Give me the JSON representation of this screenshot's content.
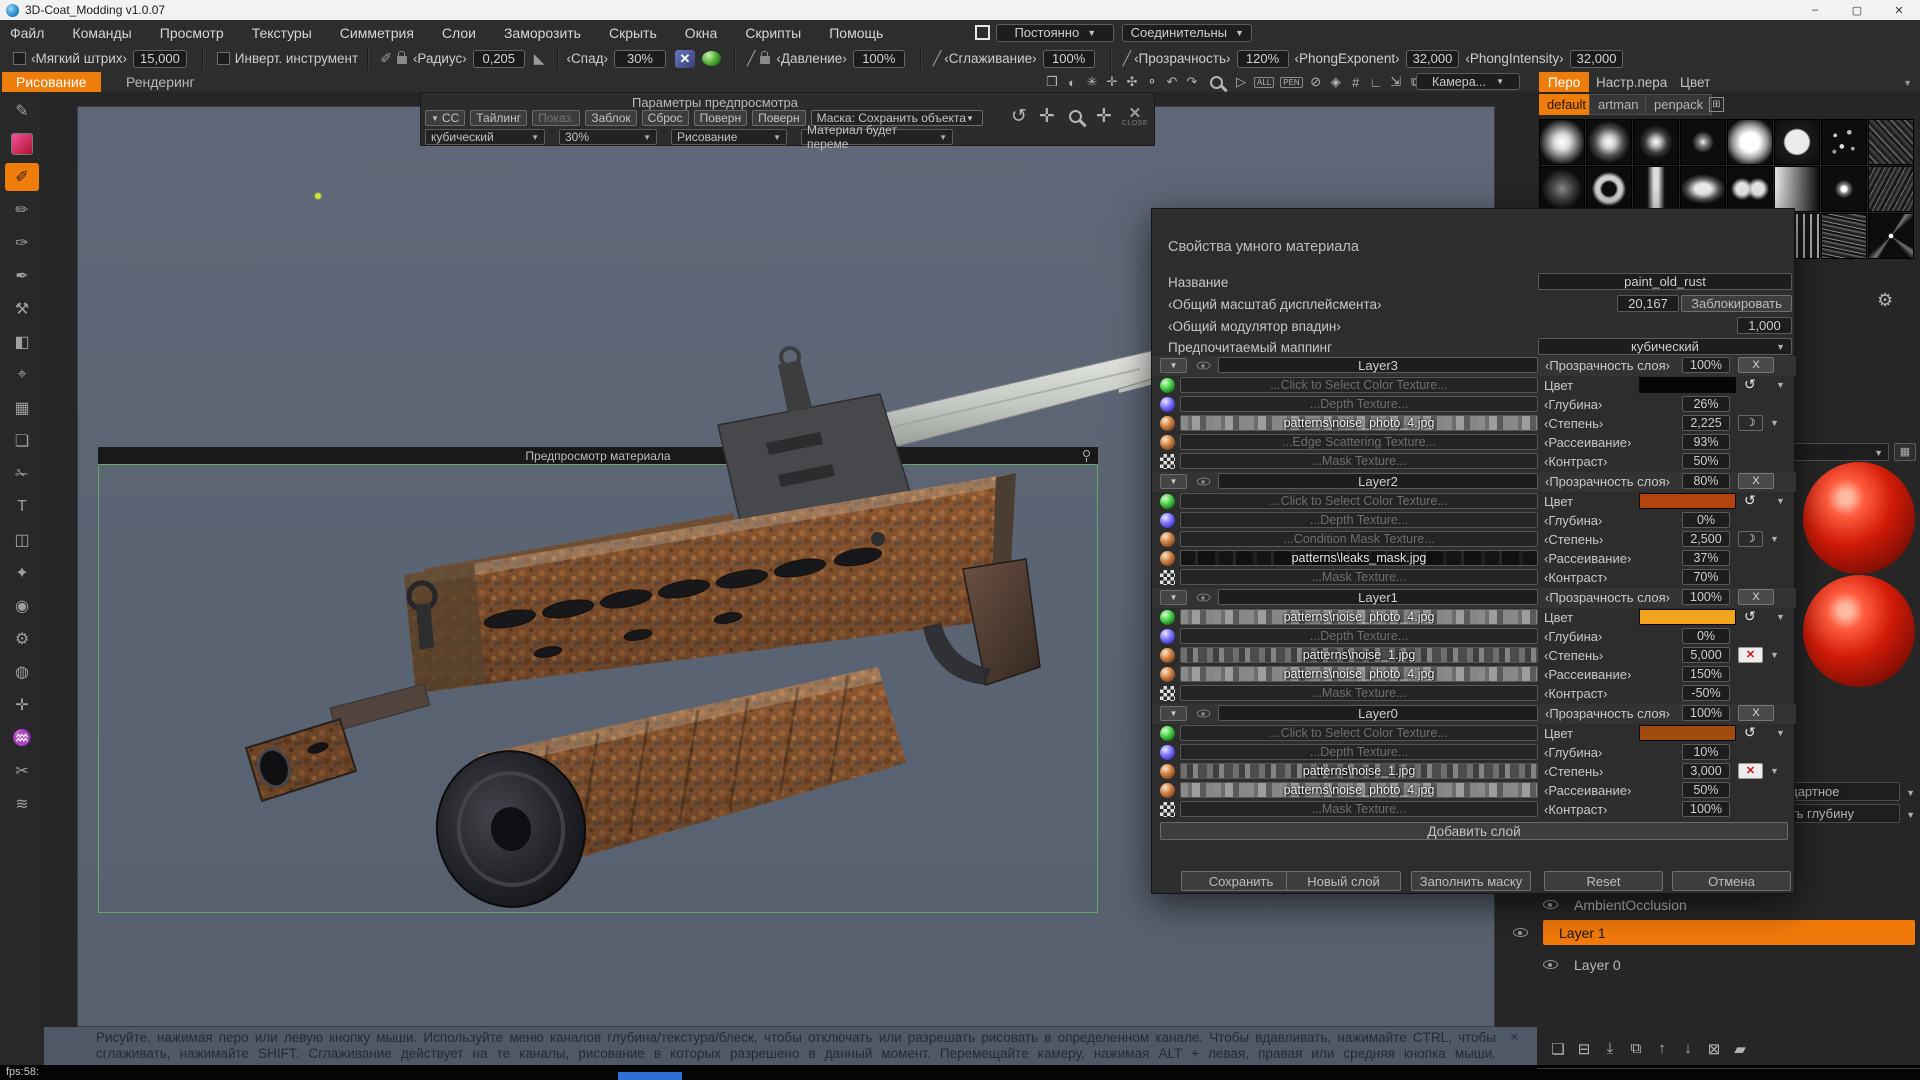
{
  "window": {
    "title": "3D-Coat_Modding v1.0.07",
    "minimize": "–",
    "maximize": "▢",
    "close": "✕"
  },
  "menu": {
    "items": [
      "Файл",
      "Команды",
      "Просмотр",
      "Текстуры",
      "Симметрия",
      "Слои",
      "Заморозить",
      "Скрыть",
      "Окна",
      "Скрипты",
      "Помощь"
    ],
    "persist_dropdown": "Постоянно",
    "connective_dropdown": "Соединительны"
  },
  "toolbar": {
    "soft_stroke_label": "‹Мягкий штрих›",
    "soft_stroke_value": "15,000",
    "invert_label": "Инверт.  инструмент",
    "radius_label": "‹Радиус›",
    "radius_value": "0,205",
    "falloff_label": "‹Спад›",
    "falloff_value": "30%",
    "pressure_label": "‹Давление›",
    "pressure_value": "100%",
    "smoothing_label": "‹Сглаживание›",
    "smoothing_value": "100%",
    "opacity_label": "‹Прозрачность›",
    "opacity_value": "120%",
    "phong_exponent_label": "‹PhongExponent›",
    "phong_exponent_value": "32,000",
    "phong_intensity_label": "‹PhongIntensity›",
    "phong_intensity_value": "32,000"
  },
  "workspace_tabs": {
    "paint": "Рисование",
    "render": "Рендеринг"
  },
  "view_toolbar": {
    "icons": [
      {
        "name": "frame-icon",
        "g": "❒"
      },
      {
        "name": "contrast-icon",
        "g": "◐"
      },
      {
        "name": "flower-icon",
        "g": "✳"
      },
      {
        "name": "cross-icon",
        "g": "✛"
      },
      {
        "name": "hand-icon",
        "g": "✣"
      },
      {
        "name": "drop-icon",
        "g": "⚬"
      },
      {
        "name": "undo-icon",
        "g": "↶"
      },
      {
        "name": "redo-icon",
        "g": "↷"
      },
      {
        "name": "magnifier-icon",
        "g": "mag"
      },
      {
        "name": "play-icon",
        "g": "▷"
      },
      {
        "name": "select-all-button",
        "g": "ALL",
        "txt": true
      },
      {
        "name": "select-pen-button",
        "g": "PEN",
        "txt": true
      },
      {
        "name": "ban-icon",
        "g": "⊘"
      },
      {
        "name": "cube-icon",
        "g": "◈"
      },
      {
        "name": "grid-icon",
        "g": "#"
      },
      {
        "name": "axis-icon",
        "g": "∟"
      },
      {
        "name": "expand-icon",
        "g": "⇲"
      },
      {
        "name": "pages-icon",
        "g": "⧉"
      }
    ],
    "camera_label": "Камера..."
  },
  "right_tabs": {
    "pen": "Перо",
    "pen_settings": "Настр.пера",
    "color": "Цвет"
  },
  "pen_panel": {
    "tabs": [
      "default",
      "artman",
      "penpack"
    ],
    "thumbs": [
      "dot-xl",
      "dot-l",
      "dot-m",
      "dot-s",
      "dot-bright",
      "dot-hard",
      "spray",
      "noise",
      "dot-faint",
      "ring",
      "bar",
      "softrect",
      "double",
      "gradh",
      "dot-tiny",
      "noise2",
      "tex-dots",
      "tex-diag",
      "tex-grid",
      "tex-check",
      "tex-spots",
      "tex-vlines",
      "tex-noise",
      "tex-star"
    ]
  },
  "preview_params": {
    "title": "Параметры  предпросмотра",
    "buttons": [
      {
        "label": "СС",
        "pre": true
      },
      {
        "label": "Тайлинг"
      },
      {
        "label": "Показ.",
        "dim": true
      },
      {
        "label": "Заблок"
      },
      {
        "label": "Сброс"
      },
      {
        "label": "Поверн"
      },
      {
        "label": "Поверн"
      }
    ],
    "mask_dropdown": "Маска:  Сохранить  объекта",
    "dropdowns": [
      "кубический",
      "30%",
      "Рисование",
      "Материал будет переме"
    ],
    "close_label": "CLOSE"
  },
  "preview_window": {
    "title": "Предпросмотр  материала"
  },
  "material_dialog": {
    "title": "Свойства  умного  материала",
    "name_label": "Название",
    "name_value": "paint_old_rust",
    "displacement_label": "‹Общий  масштаб  дисплейсмента›",
    "displacement_value": "20,167",
    "lock_button": "Заблокировать",
    "cavity_label": "‹Общий  модулятор  впадин›",
    "cavity_value": "1,000",
    "mapping_label": "Предпочитаемый  маппинг",
    "mapping_value": "кубический",
    "opacity_label": "‹Прозрачность  слоя›",
    "row_labels": [
      "Цвет",
      "‹Глубина›",
      "‹Степень›",
      "‹Рассеивание›",
      "‹Контраст›"
    ],
    "close_x": "X",
    "add_layer_button": "Добавить  слой",
    "buttons": [
      "Сохранить",
      "Новый  слой",
      "Заполнить  маску",
      "Reset",
      "Отмена"
    ],
    "layers": [
      {
        "name": "Layer3",
        "opacity": "100%",
        "color_hex": "#060606",
        "slots": [
          {
            "t": "...Click  to  Select  Color  Texture...",
            "f": "none"
          },
          {
            "t": "...Depth  Texture...",
            "f": "none"
          },
          {
            "t": "patterns\\noise_photo_4.jpg",
            "f": "noise"
          },
          {
            "t": "...Edge  Scattering  Texture...",
            "f": "none"
          },
          {
            "t": "...Mask  Texture...",
            "f": "none"
          }
        ],
        "depth": "26%",
        "degree": "2,225",
        "degree_icon": "moon",
        "scattering": "93%",
        "contrast": "50%"
      },
      {
        "name": "Layer2",
        "opacity": "80%",
        "color_hex": "#b5430c",
        "slots": [
          {
            "t": "...Click  to  Select  Color  Texture...",
            "f": "none"
          },
          {
            "t": "...Depth  Texture...",
            "f": "none"
          },
          {
            "t": "...Condition  Mask  Texture...",
            "f": "none"
          },
          {
            "t": "patterns\\leaks_mask.jpg",
            "f": "dark"
          },
          {
            "t": "...Mask  Texture...",
            "f": "none"
          }
        ],
        "depth": "0%",
        "degree": "2,500",
        "degree_icon": "moon",
        "scattering": "37%",
        "contrast": "70%"
      },
      {
        "name": "Layer1",
        "opacity": "100%",
        "color_hex": "#f3a41e",
        "slots": [
          {
            "t": "patterns\\noise_photo_4.jpg",
            "f": "noise"
          },
          {
            "t": "...Depth  Texture...",
            "f": "none"
          },
          {
            "t": "patterns\\noise_1.jpg",
            "f": "noise2"
          },
          {
            "t": "patterns\\noise_photo_4.jpg",
            "f": "noise"
          },
          {
            "t": "...Mask  Texture...",
            "f": "none"
          }
        ],
        "depth": "0%",
        "degree": "5,000",
        "degree_icon": "redx",
        "scattering": "150%",
        "contrast": "-50%"
      },
      {
        "name": "Layer0",
        "opacity": "100%",
        "color_hex": "#a24b10",
        "slots": [
          {
            "t": "...Click  to  Select  Color  Texture...",
            "f": "none"
          },
          {
            "t": "...Depth  Texture...",
            "f": "none"
          },
          {
            "t": "patterns\\noise_1.jpg",
            "f": "noise2"
          },
          {
            "t": "patterns\\noise_photo_4.jpg",
            "f": "noise"
          },
          {
            "t": "...Mask  Texture...",
            "f": "none"
          }
        ],
        "depth": "10%",
        "degree": "3,000",
        "degree_icon": "redx",
        "scattering": "50%",
        "contrast": "100%"
      }
    ]
  },
  "layers_panel": {
    "blend_mode": "Стандартное",
    "depth_mode": "Добавить  глубину",
    "layers": [
      {
        "name": "AmbientOcclusion",
        "selected": false
      },
      {
        "name": "Layer  1",
        "selected": true
      },
      {
        "name": "Layer  0",
        "selected": false
      }
    ],
    "tool_icons": [
      {
        "name": "new-layer-icon",
        "g": "❏"
      },
      {
        "name": "delete-layer-icon",
        "g": "⊟"
      },
      {
        "name": "import-layer-icon",
        "g": "⤓"
      },
      {
        "name": "duplicate-layer-icon",
        "g": "⧉"
      },
      {
        "name": "move-up-icon",
        "g": "↑"
      },
      {
        "name": "move-down-icon",
        "g": "↓"
      },
      {
        "name": "clear-layer-icon",
        "g": "⊠"
      },
      {
        "name": "folder-icon",
        "g": "▰"
      }
    ]
  },
  "left_toolbar": {
    "tools": [
      {
        "name": "pen-tool",
        "g": "✎"
      },
      {
        "name": "color-swatch",
        "g": "swatch"
      },
      {
        "name": "paint-brush-tool",
        "g": "✐",
        "active": true
      },
      {
        "name": "pencil-tool",
        "g": "✏"
      },
      {
        "name": "ink-pen-tool",
        "g": "✑"
      },
      {
        "name": "nib-tool",
        "g": "✒"
      },
      {
        "name": "chisel-tool",
        "g": "⚒"
      },
      {
        "name": "fill-tool",
        "g": "◧"
      },
      {
        "name": "picker-tool",
        "g": "⌖"
      },
      {
        "name": "pattern-tool",
        "g": "▦"
      },
      {
        "name": "copy-tool",
        "g": "❏"
      },
      {
        "name": "cut-tool",
        "g": "✁"
      },
      {
        "name": "text-tool",
        "g": "T"
      },
      {
        "name": "frame-tool",
        "g": "◫"
      },
      {
        "name": "sparkle-tool",
        "g": "✦"
      },
      {
        "name": "visibility-tool",
        "g": "◉"
      },
      {
        "name": "gear-tool",
        "g": "⚙"
      },
      {
        "name": "smudge-tool",
        "g": "◍"
      },
      {
        "name": "position-tool",
        "g": "✛"
      },
      {
        "name": "wave-tool",
        "g": "♒"
      },
      {
        "name": "scissors-tool",
        "g": "✂"
      },
      {
        "name": "ripple-tool",
        "g": "≋"
      }
    ]
  },
  "status_bar": {
    "line1": "Рисуйте, нажимая перо или левую кнопку мыши. Используйте меню каналов глубина/текстура/блеск, чтобы отключать или разрешать рисовать в определенном канале. Чтобы вдавливать, нажимайте CTRL, чтобы",
    "line2": "сглаживать, нажимайте SHIFT. Сглаживание действует на те каналы, рисование в которых разрешено в данный момент. Перемещайте камеру, нажимая ALT + левая, правая или средняя кнопка мыши.",
    "close": "✕",
    "fps": "fps:58:"
  },
  "colors": {
    "accent_orange": "#ee7d0c",
    "viewport": "#5b6474",
    "selected_layer": "#f1790a"
  }
}
